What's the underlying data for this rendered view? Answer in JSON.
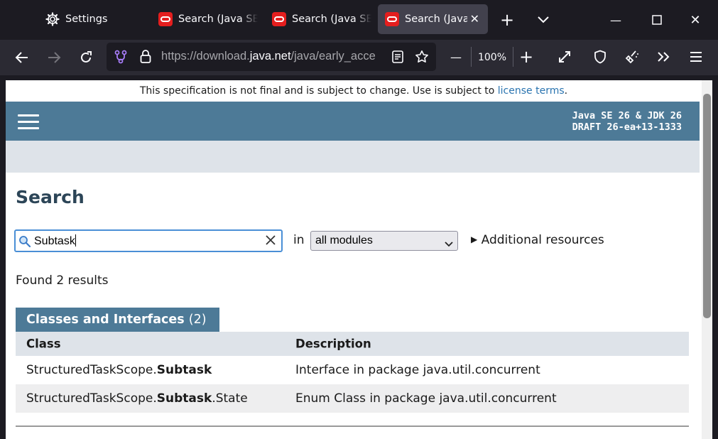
{
  "tabs": [
    {
      "label": "Settings",
      "icon": "gear-icon",
      "active": false
    },
    {
      "label": "Search (Java SE",
      "icon": "oracle-logo-icon",
      "active": false
    },
    {
      "label": "Search (Java SE",
      "icon": "oracle-logo-icon",
      "active": false
    },
    {
      "label": "Search (Java S",
      "icon": "oracle-logo-icon",
      "active": true
    }
  ],
  "tab_controls": {
    "new_tab": "+",
    "list_tabs": "⌄"
  },
  "window_controls": {
    "minimize": "—",
    "maximize": "☐",
    "close": "✕"
  },
  "navbar": {
    "url_prefix": "https://download.",
    "url_host": "java.net",
    "url_rest": "/java/early_acce",
    "zoom": "100%",
    "zoom_out": "—",
    "zoom_in": "+"
  },
  "page": {
    "banner_text": "This specification is not final and is subject to change. Use is subject to ",
    "banner_link": "license terms",
    "banner_end": ".",
    "about_line1": "Java SE 26 & JDK 26",
    "about_line2": "DRAFT 26-ea+13-1333",
    "title": "Search",
    "search_value": "Subtask",
    "in_label": "in",
    "module_select": "all modules",
    "additional_resources": "Additional resources",
    "found": "Found 2 results",
    "section_title": "Classes and Interfaces",
    "section_count": "(2)",
    "col_class": "Class",
    "col_description": "Description",
    "rows": [
      {
        "prefix": "StructuredTaskScope.",
        "match": "Subtask",
        "suffix": "",
        "description": "Interface in package java.util.concurrent"
      },
      {
        "prefix": "StructuredTaskScope.",
        "match": "Subtask",
        "suffix": ".State",
        "description": "Enum Class in package java.util.concurrent"
      }
    ]
  },
  "colors": {
    "header": "#4d7a97",
    "subnav": "#dee3e9",
    "link": "#2a74b0",
    "browser_dark": "#1c1b22"
  }
}
